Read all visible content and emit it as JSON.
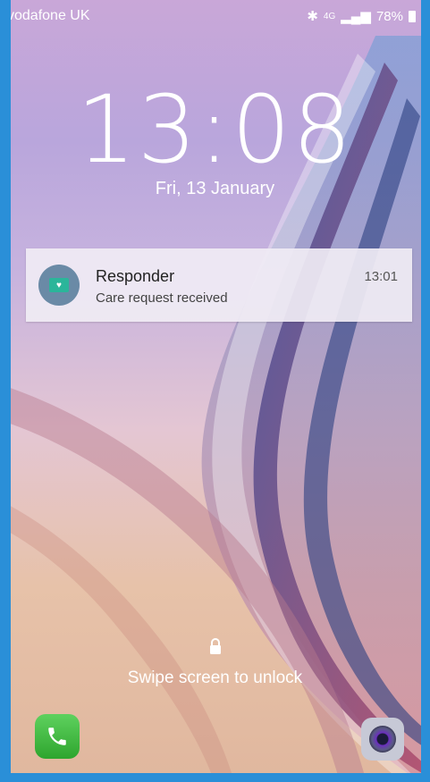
{
  "status_bar": {
    "carrier": "vodafone UK",
    "network": "4G",
    "battery": "78%",
    "icons": [
      "bluetooth-icon",
      "signal-icon",
      "battery-icon"
    ]
  },
  "lockscreen": {
    "time": "13:08",
    "date": "Fri, 13 January",
    "unlock_hint": "Swipe screen to unlock"
  },
  "notification": {
    "app": "Responder",
    "message": "Care request received",
    "time": "13:01"
  },
  "shortcuts": {
    "left": "phone-icon",
    "right": "camera-icon"
  },
  "colors": {
    "frame": "#2a8fd8",
    "phone_green": "#3cb63c"
  }
}
